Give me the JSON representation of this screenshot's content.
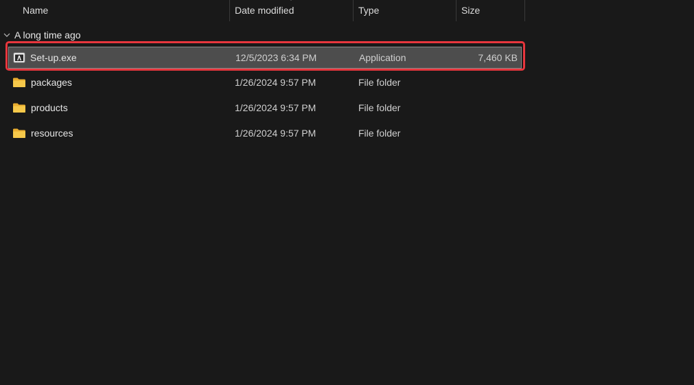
{
  "columns": {
    "name": "Name",
    "date_modified": "Date modified",
    "type": "Type",
    "size": "Size"
  },
  "group": {
    "label": "A long time ago",
    "expanded": true
  },
  "files": [
    {
      "name": "Set-up.exe",
      "date": "12/5/2023 6:34 PM",
      "type": "Application",
      "size": "7,460 KB",
      "icon": "adobe-app-icon",
      "selected": true
    },
    {
      "name": "packages",
      "date": "1/26/2024 9:57 PM",
      "type": "File folder",
      "size": "",
      "icon": "folder-icon",
      "selected": false
    },
    {
      "name": "products",
      "date": "1/26/2024 9:57 PM",
      "type": "File folder",
      "size": "",
      "icon": "folder-icon",
      "selected": false
    },
    {
      "name": "resources",
      "date": "1/26/2024 9:57 PM",
      "type": "File folder",
      "size": "",
      "icon": "folder-icon",
      "selected": false
    }
  ],
  "colors": {
    "background": "#191919",
    "selection": "#4d4d4d",
    "highlight_outline": "#e8363d",
    "folder": "#f6c84a"
  }
}
